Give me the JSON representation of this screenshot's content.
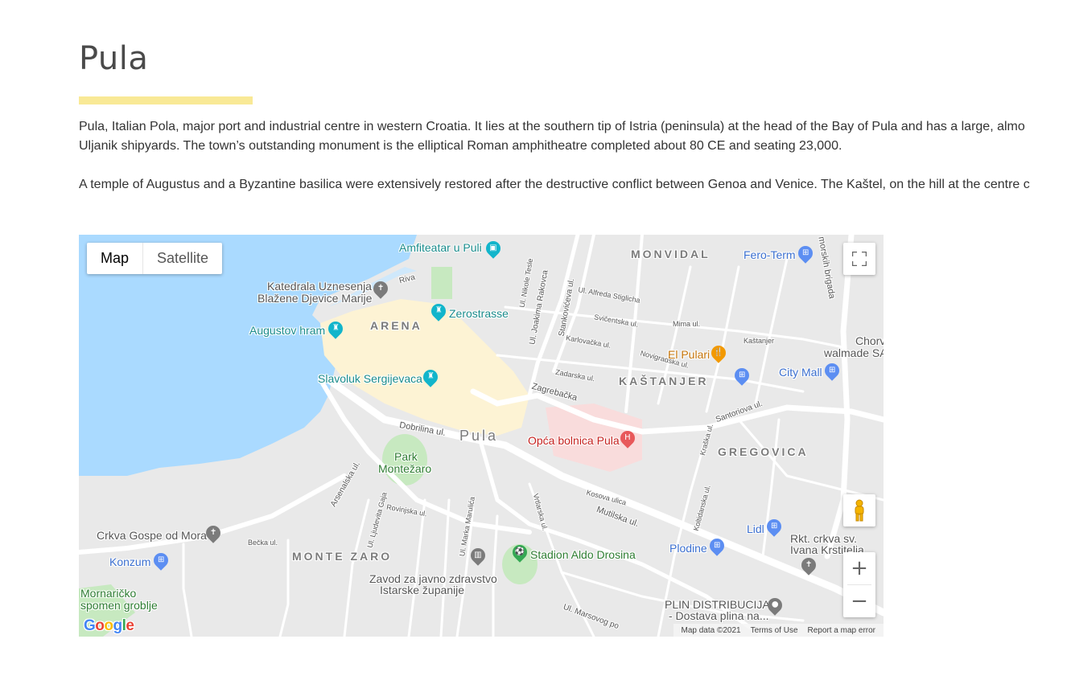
{
  "page": {
    "title": "Pula",
    "paragraphs": [
      [
        "Pula, Italian Pola, major port and industrial centre in western Croatia. It lies at the southern tip of Istria (peninsula) at the head of the Bay of Pula and has a large, almo",
        "Uljanik shipyards. The town’s outstanding monument is the elliptical Roman amphitheatre completed about 80 CE and seating 23,000."
      ],
      [
        "A temple of Augustus and a Byzantine basilica were extensively restored after the destructive conflict between Genoa and Venice. The Kaštel, on the hill at the centre c"
      ]
    ]
  },
  "map": {
    "type_buttons": {
      "map": "Map",
      "satellite": "Satellite"
    },
    "zoom": {
      "in": "+",
      "out": "−"
    },
    "districts": {
      "monvidal": "MONVIDAL",
      "arena": "ARENA",
      "kastanjer": "KAŠTANJER",
      "gregovica": "GREGOVICA",
      "monte_zaro": "MONTE ZARO",
      "pula": "Pula"
    },
    "pois": {
      "amfiteatar": "Amfiteatar u Puli",
      "katedrala_1": "Katedrala Uznesenja",
      "katedrala_2": "Blažene Djevice Marije",
      "zerostrasse": "Zerostrasse",
      "augustov": "Augustov hram",
      "slavoluk": "Slavoluk Sergijevaca",
      "park_1": "Park",
      "park_2": "Montežaro",
      "bolnica": "Opća bolnica Pula",
      "el_pulari": "El Pulari",
      "fero_term": "Fero-Term",
      "city_mall": "City Mall",
      "chorv_1": "Chorv",
      "chorv_2": "walmade SA",
      "crkva_gospe": "Crkva Gospe od Mora",
      "konzum": "Konzum",
      "mornaricko_1": "Mornaričko",
      "mornaricko_2": "spomen groblje",
      "stadion": "Stadion Aldo Drosina",
      "zavod_1": "Zavod za javno zdravstvo",
      "zavod_2": "Istarske županije",
      "plodine": "Plodine",
      "lidl": "Lidl",
      "rkt_1": "Rkt. crkva sv.",
      "rkt_2": "Ivana Krstitelja",
      "plin_1": "PLIN DISTRIBUCIJA",
      "plin_2": "- Dostava plina na..."
    },
    "streets": {
      "riva": "Riva",
      "zagrebacka": "Zagrebačka",
      "dobrilina": "Dobrilina ul.",
      "arsenalska": "Arsenalska ul.",
      "mutilska": "Mutilska ul.",
      "santoriova": "Santoriova ul.",
      "joakima": "Ul. Joakima Rakovca",
      "stankoviceva": "Stankovićeva ul.",
      "nikole_tesle": "Ul. Nikole Tesle",
      "marka_marulica": "Ul. Marka Marulića",
      "marsovog": "Ul. Marsovog po",
      "kosova": "Kosova ulica",
      "becka": "Bečka ul.",
      "mima": "Mima ul.",
      "kastanjer_st": "Kaštanjer",
      "novigradska": "Novigradska ul.",
      "karlovacka": "Karlovačka ul.",
      "zadarska": "Zadarska ul.",
      "svicentska": "Svičentska ul.",
      "alfreda": "Ul. Alfreda Stiglicha",
      "ljudevita": "Ul. Ljudevita Gaja",
      "rovinjska": "Rovinjska ul.",
      "kraska": "Kraška ul.",
      "koltidanska": "Koltidanska ul.",
      "vrtlarska": "Vrtlarska ul.",
      "morskih": "morskih brigada"
    },
    "attribution": {
      "map_data": "Map data ©2021",
      "terms": "Terms of Use",
      "report": "Report a map error"
    },
    "logo": {
      "g1": "G",
      "o1": "o",
      "o2": "o",
      "g2": "g",
      "l": "l",
      "e": "e"
    },
    "colors": {
      "water": "#aadaff",
      "land": "#e9e9e9",
      "road": "#ffffff",
      "old_town": "#fdf3d4",
      "park": "#c7e9c0",
      "hospital": "#f9dcdc"
    }
  }
}
